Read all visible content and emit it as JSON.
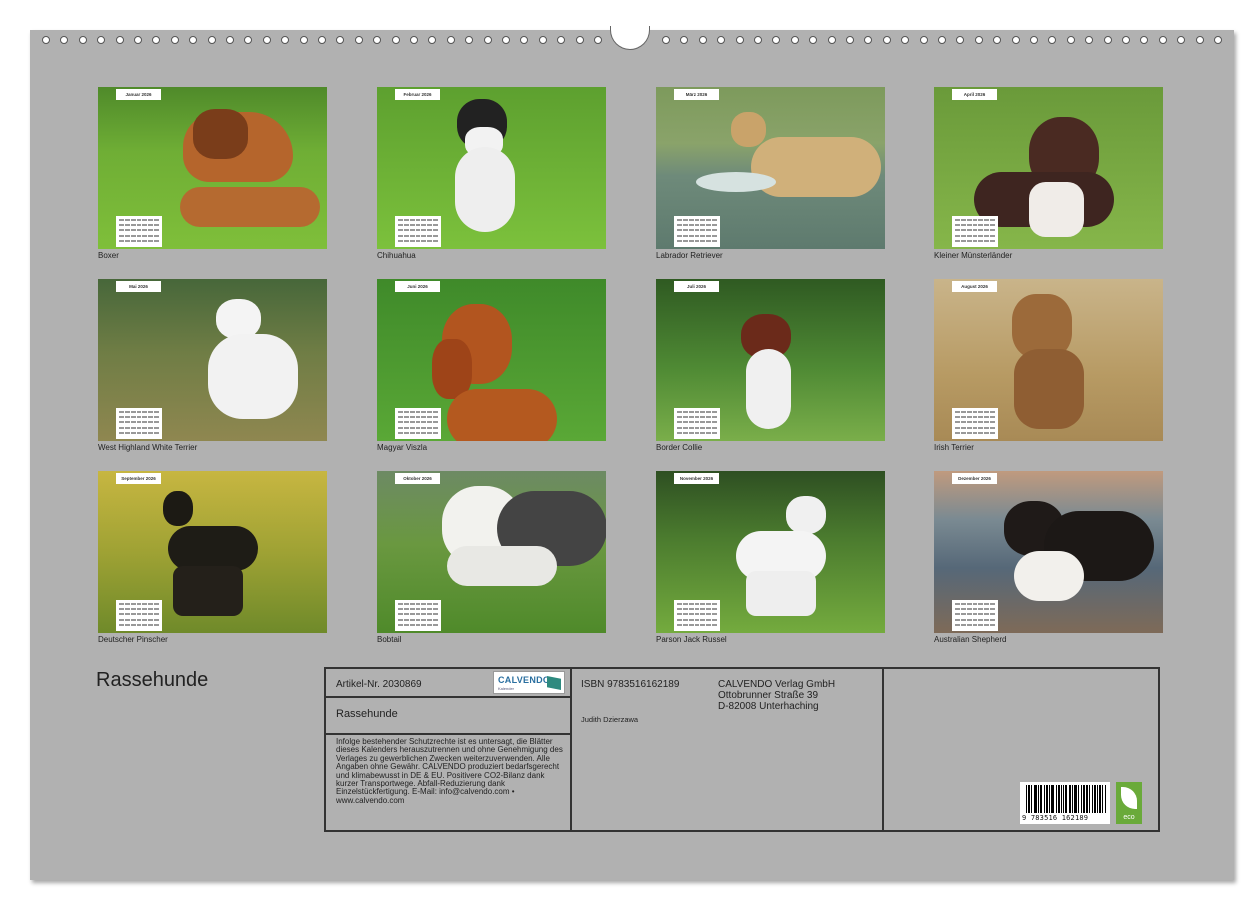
{
  "calendar": {
    "title": "Rassehunde",
    "months": [
      {
        "month": "Januar 2026",
        "breed": "Boxer",
        "icon": "boxer-dog-photo"
      },
      {
        "month": "Februar 2026",
        "breed": "Chihuahua",
        "icon": "chihuahua-dog-photo"
      },
      {
        "month": "März 2026",
        "breed": "Labrador Retriever",
        "icon": "labrador-dog-photo"
      },
      {
        "month": "April 2026",
        "breed": "Kleiner Münsterländer",
        "icon": "muensterlaender-dog-photo"
      },
      {
        "month": "Mai 2026",
        "breed": "West Highland White Terrier",
        "icon": "westie-dog-photo"
      },
      {
        "month": "Juni 2026",
        "breed": "Magyar Viszla",
        "icon": "viszla-dog-photo"
      },
      {
        "month": "Juli 2026",
        "breed": "Border Collie",
        "icon": "border-collie-dog-photo"
      },
      {
        "month": "August 2026",
        "breed": "Irish Terrier",
        "icon": "irish-terrier-dog-photo"
      },
      {
        "month": "September 2026",
        "breed": "Deutscher Pinscher",
        "icon": "pinscher-dog-photo"
      },
      {
        "month": "Oktober 2026",
        "breed": "Bobtail",
        "icon": "bobtail-dog-photo"
      },
      {
        "month": "November 2026",
        "breed": "Parson Jack Russel",
        "icon": "parson-jack-russel-dog-photo"
      },
      {
        "month": "Dezember 2026",
        "breed": "Australian Shepherd",
        "icon": "australian-shepherd-dog-photo"
      }
    ]
  },
  "info": {
    "article": "Artikel-Nr. 2030869",
    "logo_text": "CALVENDO",
    "logo_sub": "Kalender",
    "product_title": "Rassehunde",
    "legal": "Infolge bestehender Schutzrechte ist es untersagt, die Blätter dieses Kalenders herauszutrennen und ohne Genehmigung des Verlages zu gewerblichen Zwecken weiterzuverwenden. Alle Angaben ohne Gewähr. CALVENDO produziert bedarfsgerecht und klimabewusst in DE & EU. Positivere CO2-Bilanz dank kurzer Transportwege. Abfall-Reduzierung dank Einzelstückfertigung. E-Mail: info@calvendo.com • www.calvendo.com",
    "isbn": "ISBN 9783516162189",
    "author": "Judith Dzierzawa",
    "publisher_line1": "CALVENDO Verlag GmbH",
    "publisher_line2": "Ottobrunner Straße 39",
    "publisher_line3": "D-82008 Unterhaching",
    "barcode_digits": "9 783516 162189",
    "eco_label": "eco"
  },
  "colors": {
    "sheet": "#b1b1b1",
    "eco_green": "#6aaa3a",
    "logo_blue": "#2a6fa0"
  }
}
